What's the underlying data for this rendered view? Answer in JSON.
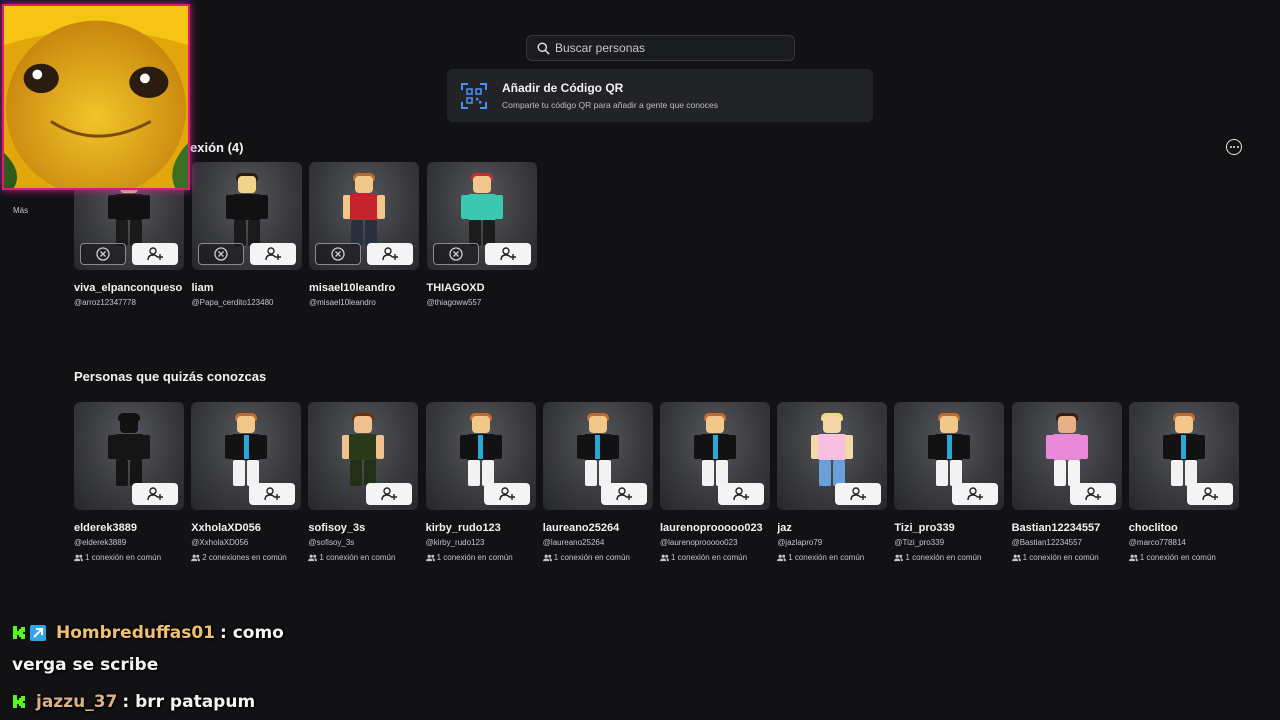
{
  "search": {
    "placeholder": "Buscar personas"
  },
  "qr": {
    "title": "Añadir de Código QR",
    "description": "Comparte tu código QR para añadir a gente que conoces"
  },
  "requests": {
    "title": "exión (4)",
    "items": [
      {
        "name": "viva_elpanconqueso",
        "handle": "@arroz12347778"
      },
      {
        "name": "liam",
        "handle": "@Papa_cerdito123480"
      },
      {
        "name": "misael10leandro",
        "handle": "@misael10leandro"
      },
      {
        "name": "THIAGOXD",
        "handle": "@thiagoww557"
      }
    ]
  },
  "suggestions": {
    "title": "Personas que quizás conozcas",
    "items": [
      {
        "name": "elderek3889",
        "handle": "@elderek3889",
        "mutual": "1 conexión en común"
      },
      {
        "name": "XxholaXD056",
        "handle": "@XxholaXD056",
        "mutual": "2 conexiones en común"
      },
      {
        "name": "sofisoy_3s",
        "handle": "@sofisoy_3s",
        "mutual": "1 conexión en común"
      },
      {
        "name": "kirby_rudo123",
        "handle": "@kirby_rudo123",
        "mutual": "1 conexión en común"
      },
      {
        "name": "laureano25264",
        "handle": "@laureano25264",
        "mutual": "1 conexión en común"
      },
      {
        "name": "laurenoprooooo023",
        "handle": "@laurenoprooooo023",
        "mutual": "1 conexión en común"
      },
      {
        "name": "jaz",
        "handle": "@jazlapro79",
        "mutual": "1 conexión en común"
      },
      {
        "name": "Tizi_pro339",
        "handle": "@Tizi_pro339",
        "mutual": "1 conexión en común"
      },
      {
        "name": "Bastian12234557",
        "handle": "@Bastian12234557",
        "mutual": "1 conexión en común"
      },
      {
        "name": "choclitoo",
        "handle": "@marco778814",
        "mutual": "1 conexión en común"
      }
    ]
  },
  "sidebar": {
    "more_label": "Más"
  },
  "chat": [
    {
      "user": "Hombreduffas01",
      "text": ": como"
    },
    {
      "text": "verga se scribe"
    },
    {
      "user": "jazzu_37",
      "text": ": brr patapum"
    }
  ],
  "icons": {
    "search": "search-icon",
    "qr": "qr-code-icon",
    "add_friend": "add-friend-icon",
    "decline": "decline-icon",
    "more": "more-options-icon",
    "mutual": "mutual-connections-icon"
  }
}
